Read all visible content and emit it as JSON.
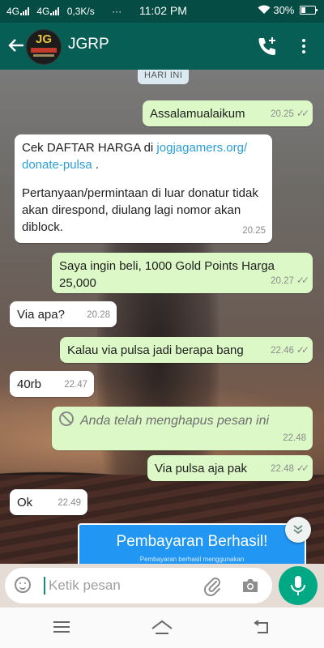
{
  "status_bar": {
    "network1": "4G",
    "network2": "4G",
    "speed": "0,3K/s",
    "dots": "···",
    "time": "11:02 PM",
    "battery": "30%"
  },
  "app_bar": {
    "avatar_text": "JG",
    "title": "JGRP"
  },
  "chat": {
    "date_chip": "HARI INI",
    "messages": [
      {
        "text": "Assalamualaikum",
        "time": "20.25"
      },
      {
        "text1": "Cek DAFTAR HARGA di ",
        "link": "jogjagamers.org/\ndonate-pulsa",
        "text2": " .",
        "text3": "Pertanyaan/permintaan di luar donatur tidak akan direspond, diulang lagi nomor akan diblock.",
        "time": "20.25"
      },
      {
        "text": "Saya ingin beli,  1000 Gold Points Harga 25,000",
        "time": "20.27"
      },
      {
        "text": "Via apa?",
        "time": "20.28"
      },
      {
        "text": "Kalau via pulsa jadi berapa bang",
        "time": "22.46"
      },
      {
        "text": "40rb",
        "time": "22.47"
      },
      {
        "text": "Anda telah menghapus pesan ini",
        "time": "22.48"
      },
      {
        "text": "Via pulsa aja pak",
        "time": "22.48"
      },
      {
        "text": "Ok",
        "time": "22.49"
      }
    ],
    "payment_card": {
      "title": "Pembayaran Berhasil!",
      "subtitle": "Pembayaran berhasil menggunakan"
    }
  },
  "input": {
    "placeholder": "Ketik pesan"
  },
  "colors": {
    "header": "#075e54",
    "outgoing_bubble": "#dcf8c6",
    "incoming_bubble": "#ffffff",
    "accent": "#00a884",
    "link": "#2a9fd8"
  }
}
